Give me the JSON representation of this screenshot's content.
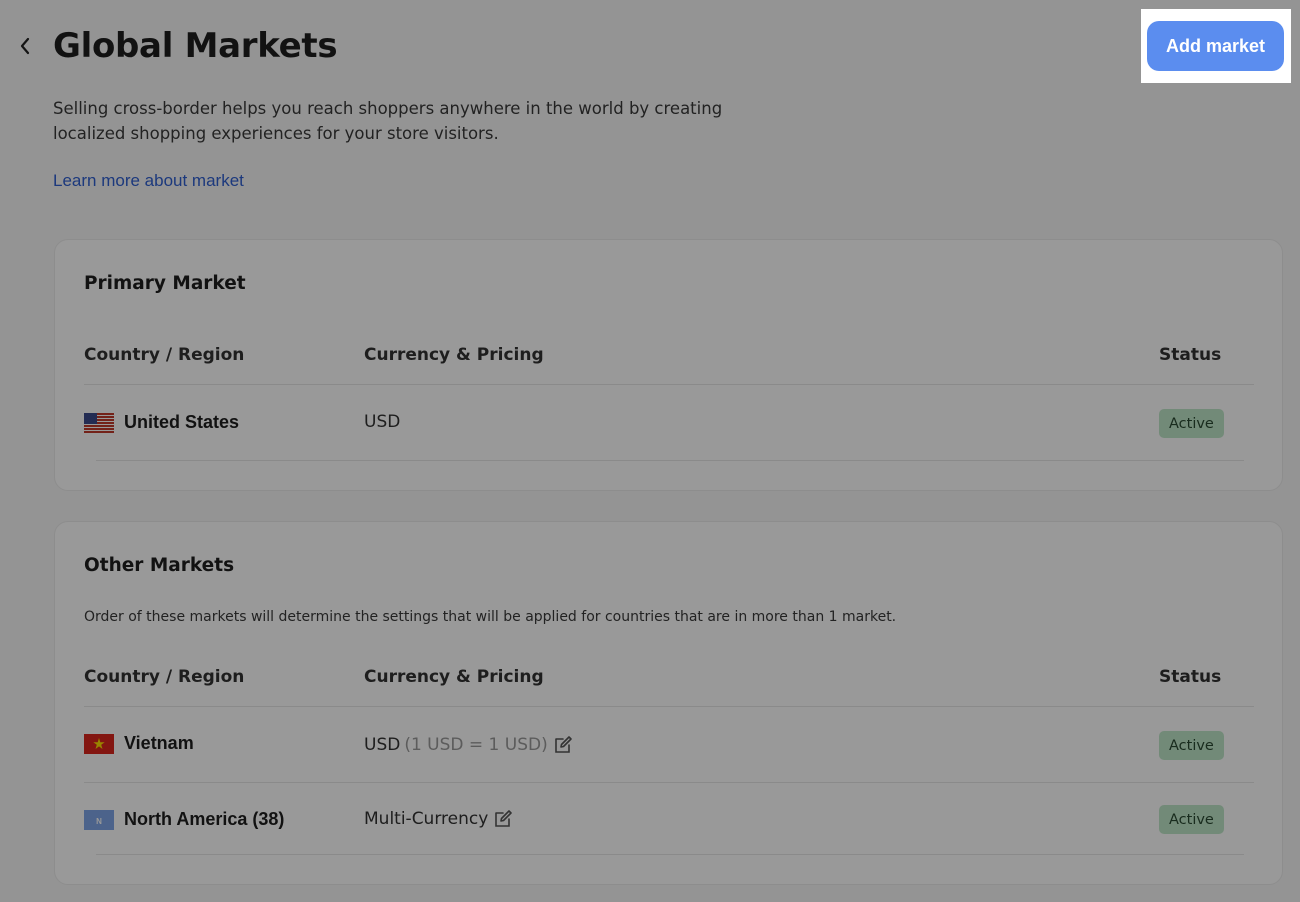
{
  "header": {
    "title": "Global Markets",
    "description": "Selling cross-border helps you reach shoppers anywhere in the world by creating localized shopping experiences for your store visitors.",
    "learn_link": "Learn more about market",
    "add_button": "Add market"
  },
  "columns": {
    "country": "Country / Region",
    "currency": "Currency & Pricing",
    "status": "Status"
  },
  "primary": {
    "heading": "Primary Market",
    "rows": [
      {
        "country": "United States",
        "flag": "us-flag-icon",
        "currency": "USD",
        "status": "Active"
      }
    ]
  },
  "other": {
    "heading": "Other Markets",
    "note": "Order of these markets will determine the settings that will be applied for countries that are in more than 1 market.",
    "rows": [
      {
        "country": "Vietnam",
        "flag": "vietnam-flag-icon",
        "currency": "USD",
        "rate": "(1 USD = 1 USD)",
        "status": "Active"
      },
      {
        "country": "North America (38)",
        "flag": "north-america-icon",
        "flag_letter": "N",
        "currency": "Multi-Currency",
        "status": "Active"
      }
    ]
  },
  "colors": {
    "accent": "#5b8def",
    "link": "#2f5fd0",
    "active_badge": "#bfe6c8",
    "overlay": "rgba(0,0,0,0.4)"
  }
}
